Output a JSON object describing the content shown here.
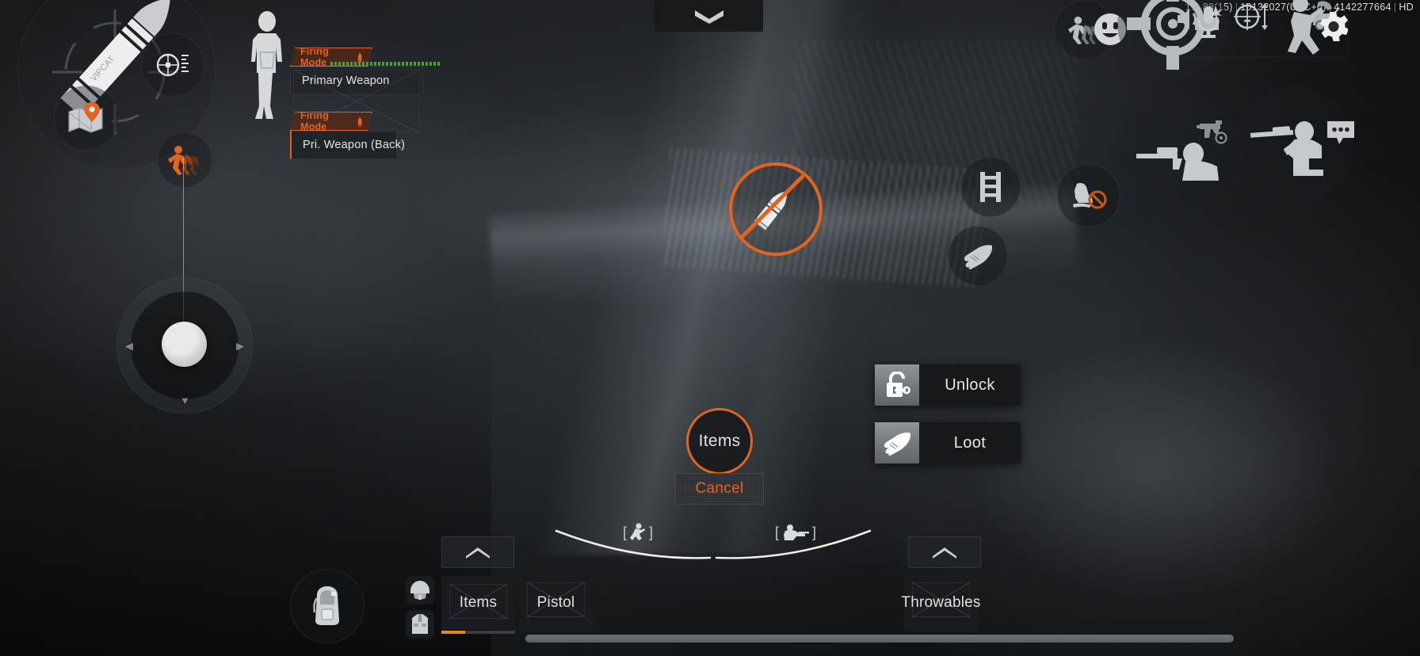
{
  "meta": {
    "app": "mobile-battle-royale-hud",
    "build_version": "1.0.88(15)",
    "build_number": "10132027(UTC+0)",
    "session_id": "4142277664",
    "quality": "HD"
  },
  "top_bar": {
    "collapse_icon": "chevron-down-icon"
  },
  "left_hud": {
    "ammo_icon": "bullet-icon",
    "scope_icon": "scope-range-icon",
    "map_icon": "map-pin-icon",
    "sprint_icon": "sprint-icon",
    "joystick_icon": "movement-joystick"
  },
  "weapon_panels": [
    {
      "id": "primary",
      "tag_label": "Firing Mode",
      "tag_icon": "bullet-icon",
      "weapon_label": "Primary Weapon",
      "ammo_bar_color": "#4f9a3c",
      "ammo_bar_visible": true
    },
    {
      "id": "primary-back",
      "tag_label": "Firing Mode",
      "tag_icon": "bullet-icon",
      "weapon_label": "Pri. Weapon (Back)",
      "ammo_bar_visible": false
    }
  ],
  "center": {
    "no_ammo_icon": "no-ammo-bullet-icon",
    "items_button_label": "Items",
    "cancel_button_label": "Cancel",
    "accent_color": "#e2641f"
  },
  "interactions": [
    {
      "label": "Unlock",
      "icon": "padlock-key-icon"
    },
    {
      "label": "Loot",
      "icon": "grab-hand-icon"
    }
  ],
  "right_actions": {
    "ladder_icon": "ladder-icon",
    "grab_icon": "grab-hand-icon",
    "no_boot_icon": "no-footstep-icon"
  },
  "right_cluster": {
    "sprint_icon": "sprint-icon",
    "emote_icon": "emote-smiley-icon",
    "aim_icon": "aim-crosshair-icon",
    "sound_icon": "sound-wave-icon",
    "mic_icon": "microphone-icon",
    "scope_icon": "scope-height-icon",
    "jump_icon": "jump-icon",
    "vehicle_icon": "vehicle-icon",
    "settings_icon": "gear-icon",
    "smg_icon": "smg-weapon-icon",
    "sniper_icon": "sniper-prone-icon",
    "prone_icon": "prone-kneel-icon",
    "chat_icon": "chat-bubble-icon"
  },
  "stance_indicators": [
    {
      "icon": "crouch-stance-icon"
    },
    {
      "icon": "prone-stance-icon"
    }
  ],
  "bottom_bar": {
    "expand_icon": "chevron-up-icon",
    "backpack_icon": "backpack-icon",
    "helmet_icon": "helmet-icon",
    "vest_icon": "vest-icon",
    "slots": [
      {
        "label": "Items",
        "progress": 32,
        "progress_color": "#e08a24"
      },
      {
        "label": "Pistol",
        "progress": 0
      },
      {
        "label": "Throwables",
        "progress": 0
      }
    ]
  }
}
